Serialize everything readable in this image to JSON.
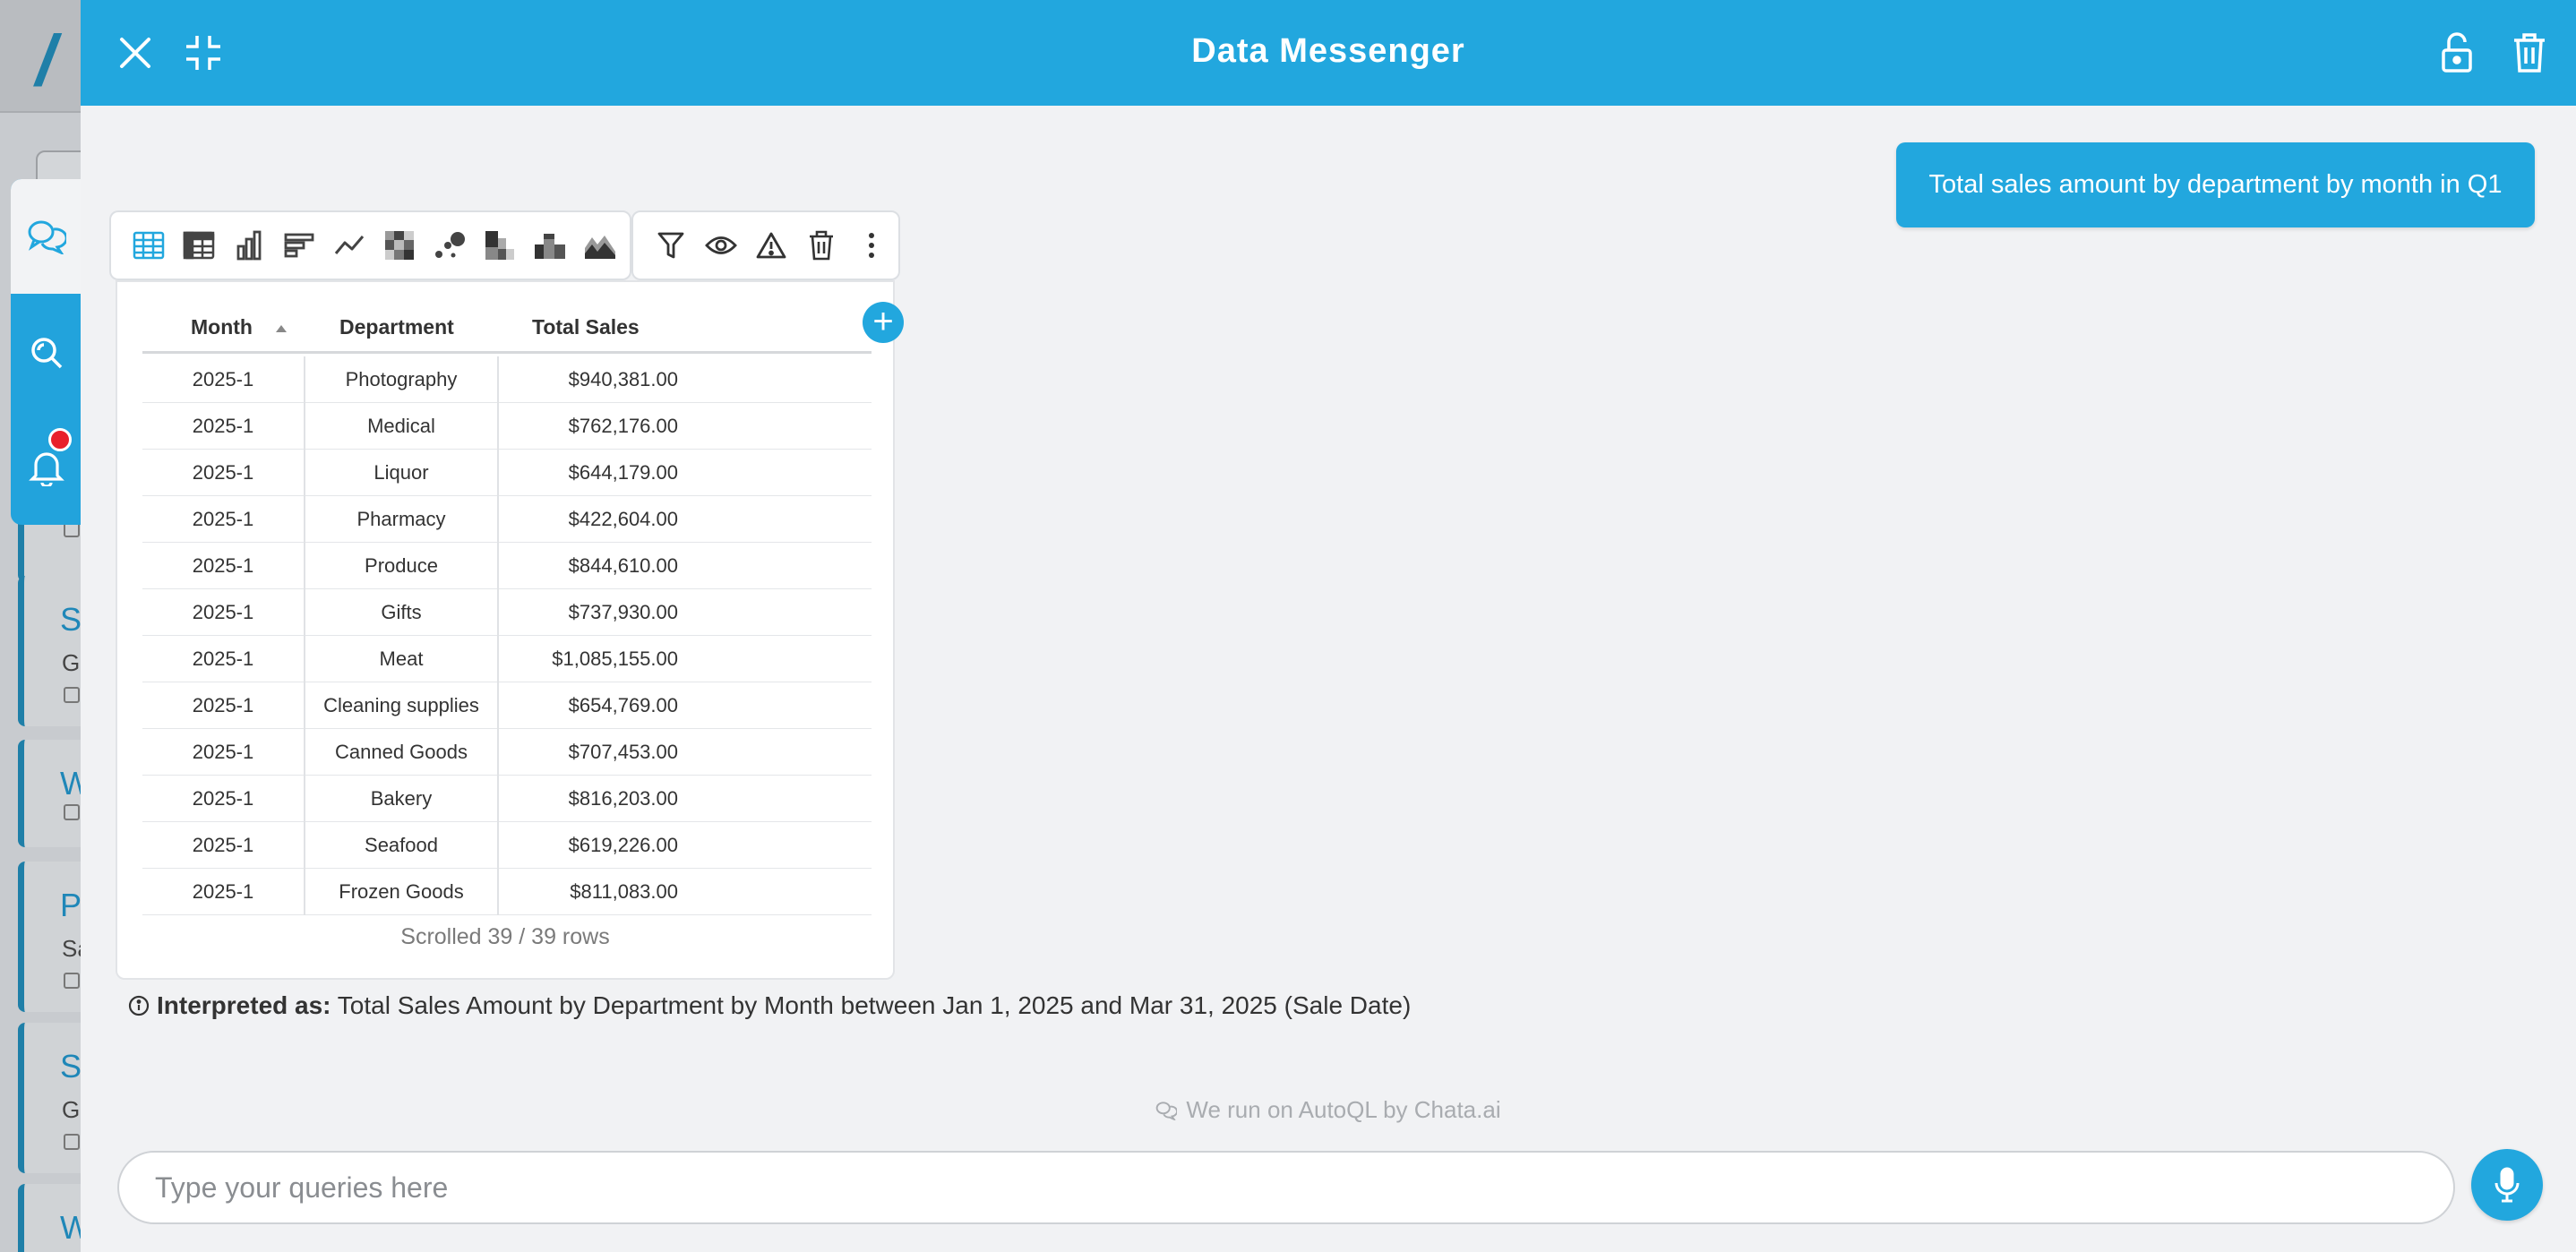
{
  "header": {
    "title": "Data Messenger"
  },
  "user_message": "Total sales amount by department by month in Q1",
  "viz_toolbar": [
    "table-icon",
    "pivot-table-icon",
    "column-chart-icon",
    "bar-chart-icon",
    "line-chart-icon",
    "heatmap-icon",
    "bubble-chart-icon",
    "stacked-column-icon",
    "stacked-bar-icon",
    "stacked-area-icon"
  ],
  "action_toolbar": [
    "filter-icon",
    "eye-icon",
    "warning-icon",
    "trash-icon",
    "more-icon"
  ],
  "table": {
    "columns": [
      "Month",
      "Department",
      "Total Sales"
    ],
    "sort_column": "Month",
    "rows": [
      [
        "2025-1",
        "Photography",
        "$940,381.00"
      ],
      [
        "2025-1",
        "Medical",
        "$762,176.00"
      ],
      [
        "2025-1",
        "Liquor",
        "$644,179.00"
      ],
      [
        "2025-1",
        "Pharmacy",
        "$422,604.00"
      ],
      [
        "2025-1",
        "Produce",
        "$844,610.00"
      ],
      [
        "2025-1",
        "Gifts",
        "$737,930.00"
      ],
      [
        "2025-1",
        "Meat",
        "$1,085,155.00"
      ],
      [
        "2025-1",
        "Cleaning supplies",
        "$654,769.00"
      ],
      [
        "2025-1",
        "Canned Goods",
        "$707,453.00"
      ],
      [
        "2025-1",
        "Bakery",
        "$816,203.00"
      ],
      [
        "2025-1",
        "Seafood",
        "$619,226.00"
      ],
      [
        "2025-1",
        "Frozen Goods",
        "$811,083.00"
      ]
    ],
    "row_count_text": "Scrolled 39 / 39 rows"
  },
  "interpretation": {
    "label": "Interpreted as:",
    "text": "Total Sales Amount by Department by Month between Jan 1, 2025 and Mar 31, 2025 (Sale Date)"
  },
  "powered_by": "We run on AutoQL by Chata.ai",
  "input": {
    "placeholder": "Type your queries here"
  },
  "colors": {
    "primary": "#22a7de",
    "notification": "#e8202a"
  }
}
